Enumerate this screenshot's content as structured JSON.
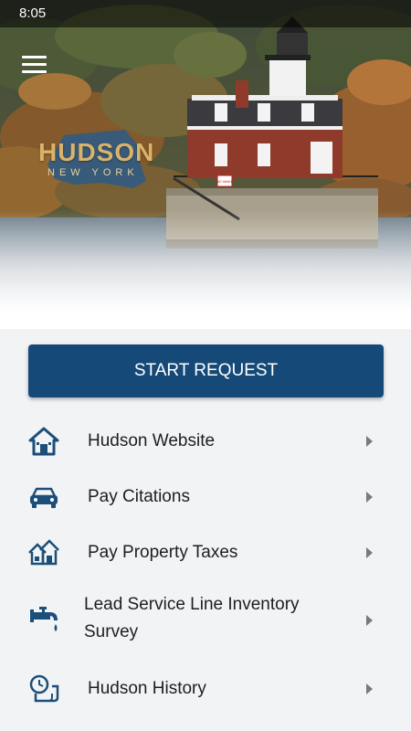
{
  "status_bar": {
    "time": "8:05"
  },
  "header": {
    "logo_title": "HUDSON",
    "logo_subtitle": "NEW YORK",
    "sign_text": "NO WAKE"
  },
  "colors": {
    "primary": "#154a78",
    "icon": "#1b4f7a",
    "chevron": "#7a7a7a",
    "logo_gold": "#d9b36a"
  },
  "start_request": {
    "label": "START REQUEST"
  },
  "menu": [
    {
      "label": "Hudson Website",
      "icon": "home-icon"
    },
    {
      "label": "Pay Citations",
      "icon": "car-icon"
    },
    {
      "label": "Pay Property Taxes",
      "icon": "houses-icon"
    },
    {
      "label": "Lead Service Line Inventory Survey",
      "icon": "faucet-icon"
    },
    {
      "label": "Hudson History",
      "icon": "history-clock-icon"
    }
  ]
}
